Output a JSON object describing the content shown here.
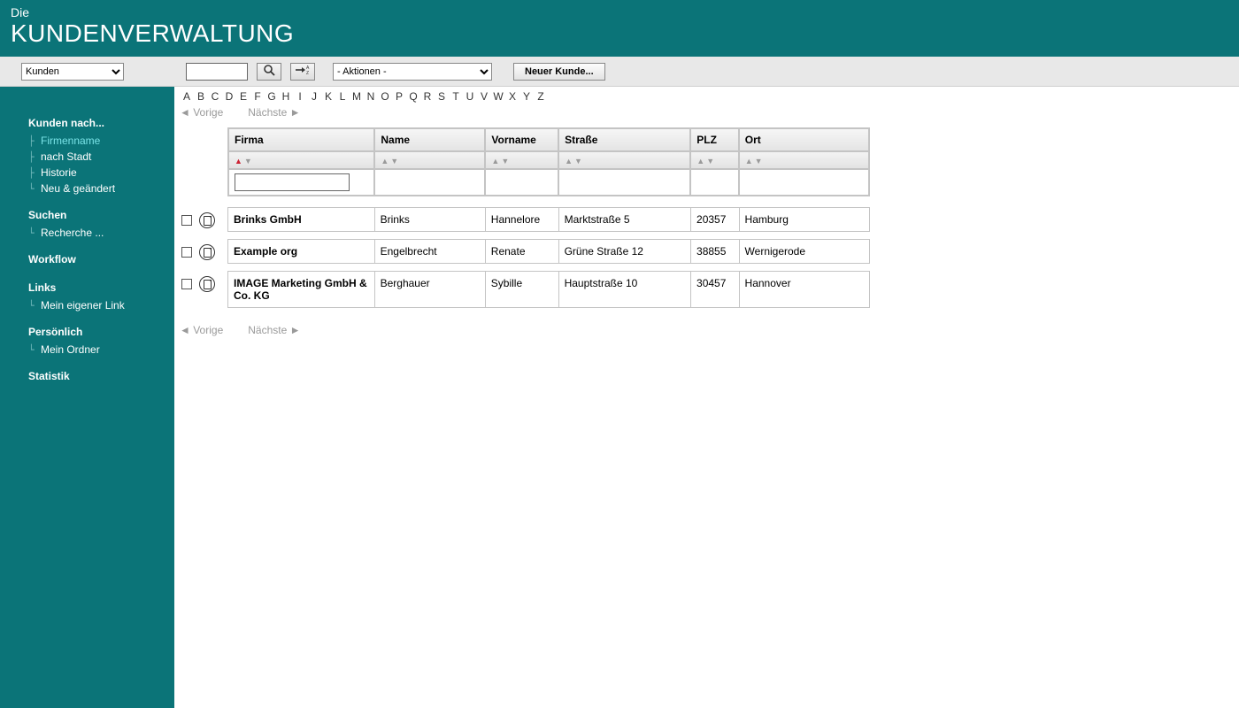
{
  "header": {
    "pre": "Die",
    "title": "KUNDENVERWALTUNG"
  },
  "toolbar": {
    "scope_selected": "Kunden",
    "actions_selected": "- Aktionen -",
    "new_customer": "Neuer Kunde..."
  },
  "sidebar": {
    "groups": [
      {
        "head": "Kunden nach...",
        "items": [
          {
            "label": "Firmenname",
            "active": true
          },
          {
            "label": "nach Stadt"
          },
          {
            "label": "Historie"
          },
          {
            "label": "Neu & geändert"
          }
        ]
      },
      {
        "head": "Suchen",
        "items": [
          {
            "label": "Recherche ..."
          }
        ]
      },
      {
        "head": "Workflow",
        "items": []
      },
      {
        "head": "Links",
        "items": [
          {
            "label": "Mein eigener Link"
          }
        ]
      },
      {
        "head": "Persönlich",
        "items": [
          {
            "label": "Mein Ordner"
          }
        ]
      },
      {
        "head": "Statistik",
        "items": []
      }
    ]
  },
  "alpha": [
    "A",
    "B",
    "C",
    "D",
    "E",
    "F",
    "G",
    "H",
    "I",
    "J",
    "K",
    "L",
    "M",
    "N",
    "O",
    "P",
    "Q",
    "R",
    "S",
    "T",
    "U",
    "V",
    "W",
    "X",
    "Y",
    "Z"
  ],
  "pager": {
    "prev": "◄ Vorige",
    "next": "Nächste ►"
  },
  "columns": {
    "firma": "Firma",
    "name": "Name",
    "vorname": "Vorname",
    "strasse": "Straße",
    "plz": "PLZ",
    "ort": "Ort"
  },
  "rows": [
    {
      "firma": "Brinks GmbH",
      "name": "Brinks",
      "vorname": "Hannelore",
      "strasse": "Marktstraße 5",
      "plz": "20357",
      "ort": "Hamburg"
    },
    {
      "firma": "Example org",
      "name": "Engelbrecht",
      "vorname": "Renate",
      "strasse": "Grüne Straße 12",
      "plz": "38855",
      "ort": "Wernigerode"
    },
    {
      "firma": "IMAGE Marketing GmbH & Co. KG",
      "name": "Berghauer",
      "vorname": "Sybille",
      "strasse": "Hauptstraße 10",
      "plz": "30457",
      "ort": "Hannover"
    }
  ]
}
